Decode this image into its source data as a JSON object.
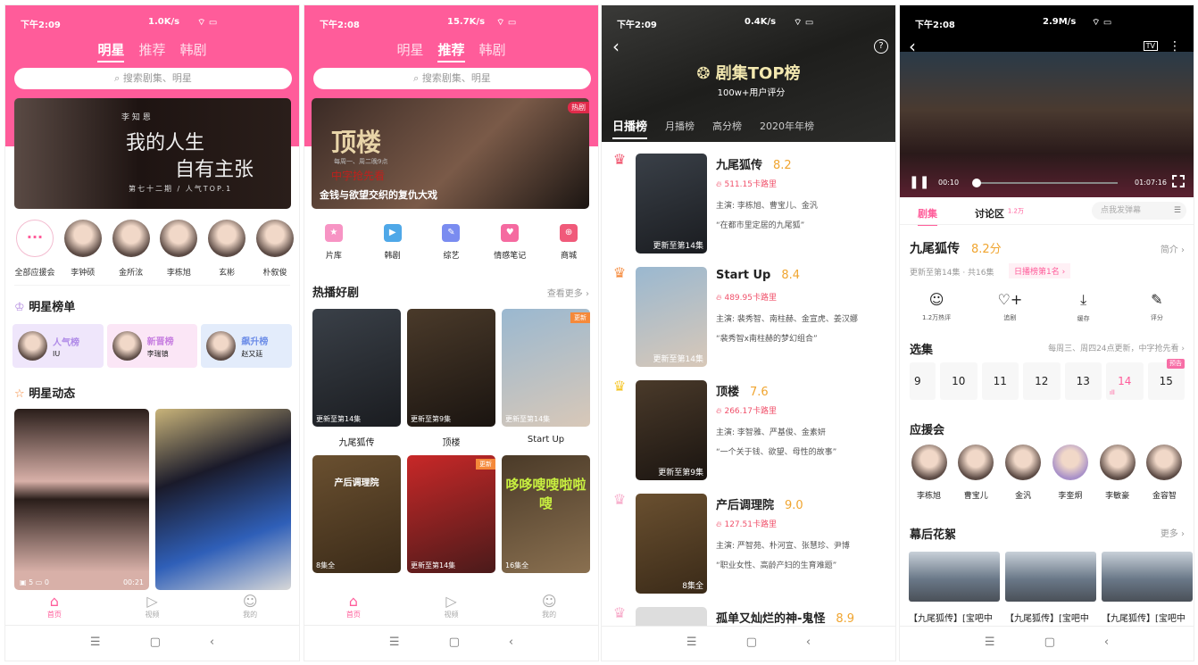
{
  "colors": {
    "brand": "#ff5c9a",
    "score": "#f0a530",
    "heat": "#f0506a"
  },
  "p1": {
    "status": {
      "time": "下午2:09",
      "net": "1.0K/s",
      "battery": "50"
    },
    "tabs": [
      "明星",
      "推荐",
      "韩剧"
    ],
    "active_tab": 0,
    "search_placeholder": "搜索剧集、明星",
    "banner": {
      "tag": "李 知 恩",
      "title1": "我的人生",
      "title2": "自有主张",
      "sub": "第七十二期 / 人气TOP.1"
    },
    "stars": [
      "全部应援会",
      "李钟硕",
      "金所泫",
      "李栋旭",
      "玄彬",
      "朴叙俊"
    ],
    "rank_title": "明星榜单",
    "ranks": [
      {
        "label": "人气榜",
        "name": "IU"
      },
      {
        "label": "新晋榜",
        "name": "李瑞镇"
      },
      {
        "label": "飙升榜",
        "name": "赵又廷"
      }
    ],
    "feed_title": "明星动态",
    "feed": {
      "videos": "5",
      "comments": "0",
      "duration": "00:21"
    }
  },
  "nav": {
    "home": "首页",
    "video": "视频",
    "mine": "我的"
  },
  "p2": {
    "status": {
      "time": "下午2:08",
      "net": "15.7K/s",
      "battery": "51"
    },
    "banner": {
      "title": "顶楼",
      "schedule": "每周一、周二晚9点",
      "slogan": "中字抢先看",
      "caption": "金钱与欲望交织的复仇大戏",
      "badge": "热剧"
    },
    "categories": [
      {
        "label": "片库",
        "icon": "folder-star"
      },
      {
        "label": "韩剧",
        "icon": "tv-play"
      },
      {
        "label": "综艺",
        "icon": "microphone"
      },
      {
        "label": "情感笔记",
        "icon": "heart-notebook"
      },
      {
        "label": "商城",
        "icon": "shopping-bag"
      }
    ],
    "hot_title": "热播好剧",
    "more": "查看更多",
    "dramas": [
      {
        "title": "九尾狐传",
        "cap": "更新至第14集"
      },
      {
        "title": "顶楼",
        "cap": "更新至第9集"
      },
      {
        "title": "Start Up",
        "cap": "更新至第14集",
        "badge": "更新"
      },
      {
        "title": "",
        "cap": "8集全",
        "poster": "产后调理院"
      },
      {
        "title": "",
        "cap": "更新至第14集",
        "badge": "更新"
      },
      {
        "title": "",
        "cap": "16集全",
        "poster": "哆哆嗖嗖啦啦嗖"
      }
    ]
  },
  "p3": {
    "status": {
      "time": "下午2:09",
      "net": "0.4K/s",
      "battery": "50"
    },
    "title": "剧集TOP榜",
    "subtitle": "100w+用户评分",
    "tabs": [
      "日播榜",
      "月播榜",
      "高分榜",
      "2020年年榜"
    ],
    "list": [
      {
        "rank": "1",
        "title": "九尾狐传",
        "score": "8.2",
        "heat": "511.15卡路里",
        "cast": "主演: 李栋旭、曹宝儿、金汎",
        "quote": "“在都市里定居的九尾狐”",
        "cap": "更新至第14集",
        "crown": "#f0506a"
      },
      {
        "rank": "2",
        "title": "Start Up",
        "score": "8.4",
        "heat": "489.95卡路里",
        "cast": "主演: 裴秀智、南柱赫、金宣虎、姜汉娜",
        "quote": "“裴秀智x南柱赫的梦幻组合”",
        "cap": "更新至第14集",
        "crown": "#f5893a"
      },
      {
        "rank": "3",
        "title": "顶楼",
        "score": "7.6",
        "heat": "266.17卡路里",
        "cast": "主演: 李智雅、严基俊、金素妍",
        "quote": "“一个关于钱、欲望、母性的故事”",
        "cap": "更新至第9集",
        "crown": "#f5c422"
      },
      {
        "rank": "4",
        "title": "产后调理院",
        "score": "9.0",
        "heat": "127.51卡路里",
        "cast": "主演: 严智苑、朴河宣、张慧珍、尹博",
        "quote": "“职业女性、高龄产妇的生育难题”",
        "cap": "8集全",
        "crown": "#f7a8c8"
      },
      {
        "rank": "5",
        "title": "孤单又灿烂的神-鬼怪",
        "score": "8.9",
        "crown": "#f7a8c8"
      }
    ]
  },
  "p4": {
    "status": {
      "time": "下午2:08",
      "net": "2.9M/s",
      "battery": "51"
    },
    "player": {
      "current": "00:10",
      "total": "01:07:16",
      "progress": 0.003
    },
    "tabs": [
      "剧集",
      "讨论区"
    ],
    "discuss_count": "1.2万",
    "danmaku_placeholder": "点我发弹幕",
    "title": "九尾狐传",
    "score": "8.2分",
    "intro": "简介",
    "meta": "更新至第14集 · 共16集",
    "rank_badge": "日播榜第1名 ›",
    "actions": [
      {
        "label": "1.2万热评",
        "icon": "comment"
      },
      {
        "label": "追剧",
        "icon": "heart-plus"
      },
      {
        "label": "缓存",
        "icon": "download"
      },
      {
        "label": "评分",
        "icon": "edit"
      }
    ],
    "episodes_title": "选集",
    "episodes_note": "每周三、周四24点更新，中字抢先看",
    "episodes": [
      "9",
      "10",
      "11",
      "12",
      "13",
      "14",
      "15"
    ],
    "current_episode": "14",
    "preview_badge": "预告",
    "fans_title": "应援会",
    "fans": [
      "李栋旭",
      "曹宝儿",
      "金汎",
      "李奎炯",
      "李敏豪",
      "金容智"
    ],
    "bts_title": "幕后花絮",
    "bts_more": "更多",
    "bts": [
      "【九尾狐传】[宝吧中",
      "【九尾狐传】[宝吧中",
      "【九尾狐传】[宝吧中"
    ]
  }
}
